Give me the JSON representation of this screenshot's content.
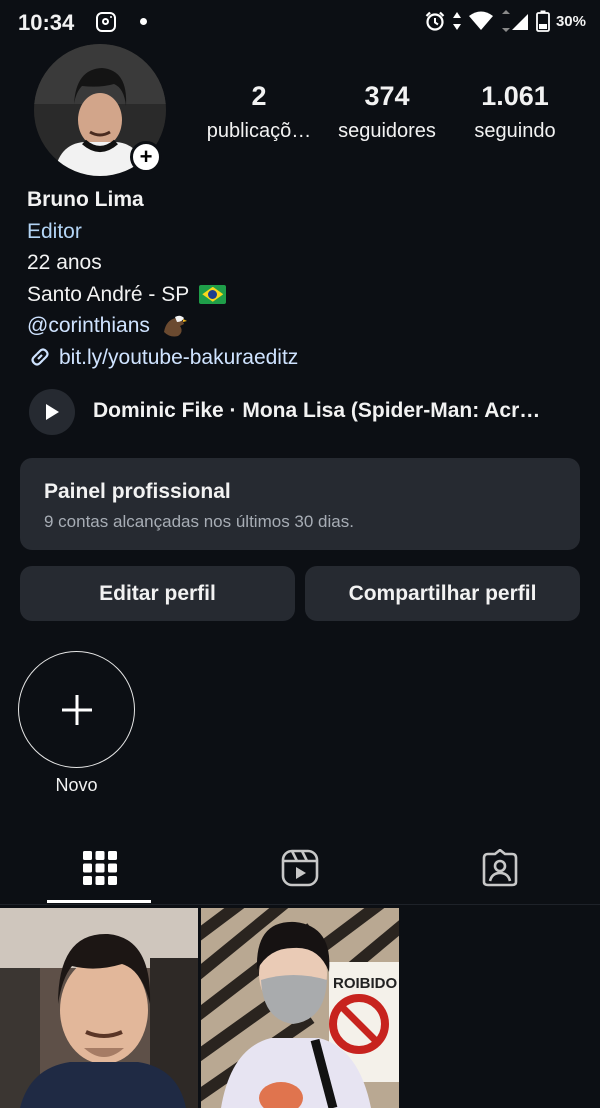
{
  "status_bar": {
    "time": "10:34",
    "battery": "30%"
  },
  "profile": {
    "stats": [
      {
        "value": "2",
        "label": "publicaçõ…"
      },
      {
        "value": "374",
        "label": "seguidores"
      },
      {
        "value": "1.061",
        "label": "seguindo"
      }
    ],
    "name": "Bruno Lima",
    "category": "Editor",
    "bio_lines": [
      "22 anos",
      "Santo André - SP",
      "@corinthians"
    ],
    "link": "bit.ly/youtube-bakuraeditz"
  },
  "music": {
    "text": "Dominic Fike · Mona Lisa (Spider-Man: Acr…"
  },
  "dashboard": {
    "title": "Painel profissional",
    "subtitle": "9 contas alcançadas nos últimos 30 dias."
  },
  "buttons": {
    "edit": "Editar perfil",
    "share": "Compartilhar perfil"
  },
  "highlights": {
    "new_label": "Novo"
  },
  "tabs": [
    {
      "icon": "grid-icon",
      "selected": true
    },
    {
      "icon": "reels-icon",
      "selected": false
    },
    {
      "icon": "tagged-icon",
      "selected": false
    }
  ],
  "posts": {
    "sign_text": "ROIBIDO"
  }
}
